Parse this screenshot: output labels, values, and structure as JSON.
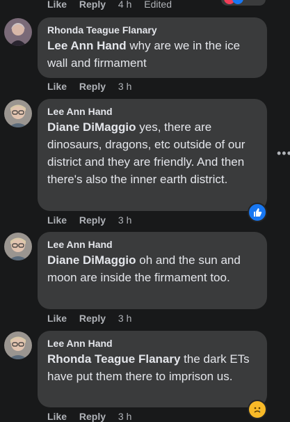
{
  "top_actions": {
    "like": "Like",
    "reply": "Reply",
    "time": "4 h",
    "edited": "Edited"
  },
  "comments": [
    {
      "author": "Rhonda Teague Flanary",
      "mention": "Lee Ann Hand",
      "text": " why are we in the ice wall and firmament",
      "like": "Like",
      "reply": "Reply",
      "time": "3 h"
    },
    {
      "author": "Lee Ann Hand",
      "mention": "Diane DiMaggio",
      "text": " yes, there are dinosaurs, dragons, etc outside of our district and they are friendly. And then there's also the inner earth district.",
      "like": "Like",
      "reply": "Reply",
      "time": "3 h",
      "reaction": "like"
    },
    {
      "author": "Lee Ann Hand",
      "mention": "Diane DiMaggio",
      "text": " oh and the sun and moon are inside the firmament too.",
      "like": "Like",
      "reply": "Reply",
      "time": "3 h"
    },
    {
      "author": "Lee Ann Hand",
      "mention": "Rhonda Teague Flanary",
      "text": " the dark ETs have put them there to imprison us.",
      "like": "Like",
      "reply": "Reply",
      "time": "3 h",
      "reaction": "sad"
    }
  ],
  "icons": {
    "more": "more-horizontal-icon",
    "like_reaction": "thumbs-up-icon",
    "sad_reaction": "sad-face-icon"
  },
  "colors": {
    "background": "#18191a",
    "bubble": "#3a3b3c",
    "text": "#e4e6eb",
    "muted": "#b0b3b8",
    "like_blue": "#1877f2",
    "sad_yellow": "#f7b928"
  }
}
